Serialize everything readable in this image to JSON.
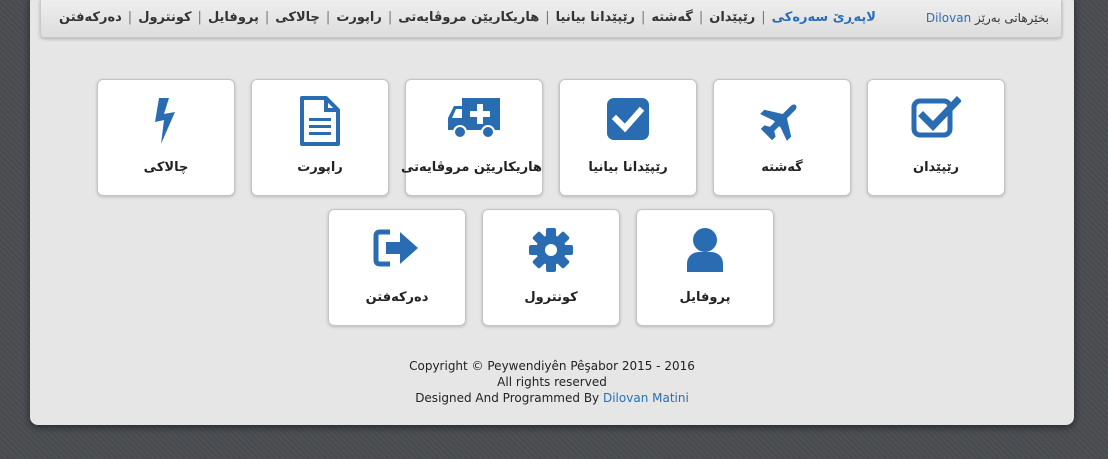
{
  "nav": {
    "welcome_prefix": "بخێرهاتی بەرێز",
    "username": "Dilovan",
    "items": [
      {
        "label": "لاپەڕێ سەرەکی",
        "active": true
      },
      {
        "label": "رێپێدان"
      },
      {
        "label": "گەشتە"
      },
      {
        "label": "رێپێدانا بیانیا"
      },
      {
        "label": "هاریکاریێن مروڤایەتی"
      },
      {
        "label": "راپورت"
      },
      {
        "label": "چالاکی"
      },
      {
        "label": "پروفایل"
      },
      {
        "label": "کونترول"
      },
      {
        "label": "دەرکەفتن"
      }
    ]
  },
  "tiles": [
    {
      "label": "رێپێدان",
      "icon": "check-square-icon"
    },
    {
      "label": "گەشتە",
      "icon": "plane-icon"
    },
    {
      "label": "رێپێدانا بیانیا",
      "icon": "check-box-icon"
    },
    {
      "label": "هاریکاریێن مروڤایەتی",
      "icon": "ambulance-icon"
    },
    {
      "label": "راپورت",
      "icon": "file-text-icon"
    },
    {
      "label": "چالاکی",
      "icon": "bolt-icon"
    },
    {
      "label": "پروفایل",
      "icon": "user-icon"
    },
    {
      "label": "کونترول",
      "icon": "gear-icon"
    },
    {
      "label": "دەرکەفتن",
      "icon": "sign-out-icon"
    }
  ],
  "footer": {
    "copyright": "Copyright © Peywendiyên Pêşabor 2015 - 2016",
    "rights": "All rights reserved",
    "designed_prefix": "Designed And Programmed By",
    "designer": "Dilovan Matini"
  },
  "colors": {
    "accent": "#2a6fb5",
    "icon": "#2a6cb1"
  }
}
